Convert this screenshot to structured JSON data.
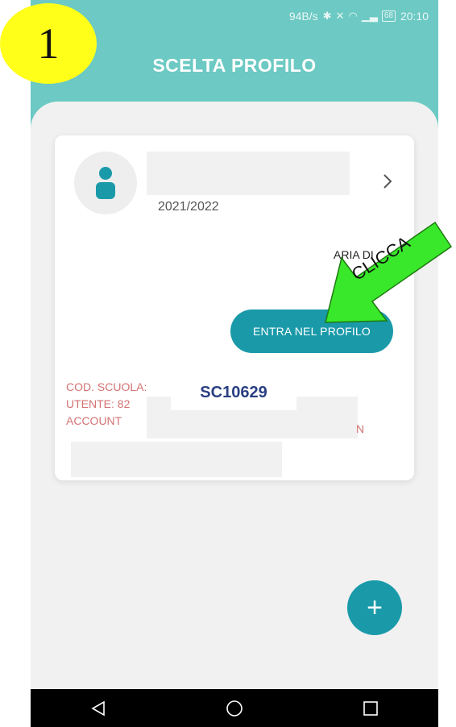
{
  "status_bar": {
    "speed": "94B/s",
    "battery": "68",
    "time": "20:10"
  },
  "header": {
    "title": "SCELTA PROFILO"
  },
  "profile_card": {
    "school_year": "2021/2022",
    "partial_text": "ARIA DI",
    "enter_button_label": "ENTRA NEL PROFILO",
    "school_code_label": "COD. SCUOLA:",
    "user_label": "UTENTE: 82",
    "account_label": "ACCOUNT",
    "stray_char": "N"
  },
  "fab": {
    "label": "+"
  },
  "annotations": {
    "step_number": "1",
    "school_code_value": "SC10629",
    "arrow_text": "CLICCA"
  },
  "colors": {
    "header_teal": "#6cc9c3",
    "button_teal": "#1a9aa9",
    "info_red": "#d47272",
    "badge_yellow": "#ffff1a",
    "arrow_green": "#39e82a"
  },
  "icons": {
    "avatar": "person-icon",
    "chevron": "chevron-right-icon",
    "nav_back": "back-triangle-icon",
    "nav_home": "home-circle-icon",
    "nav_recent": "recent-square-icon"
  }
}
